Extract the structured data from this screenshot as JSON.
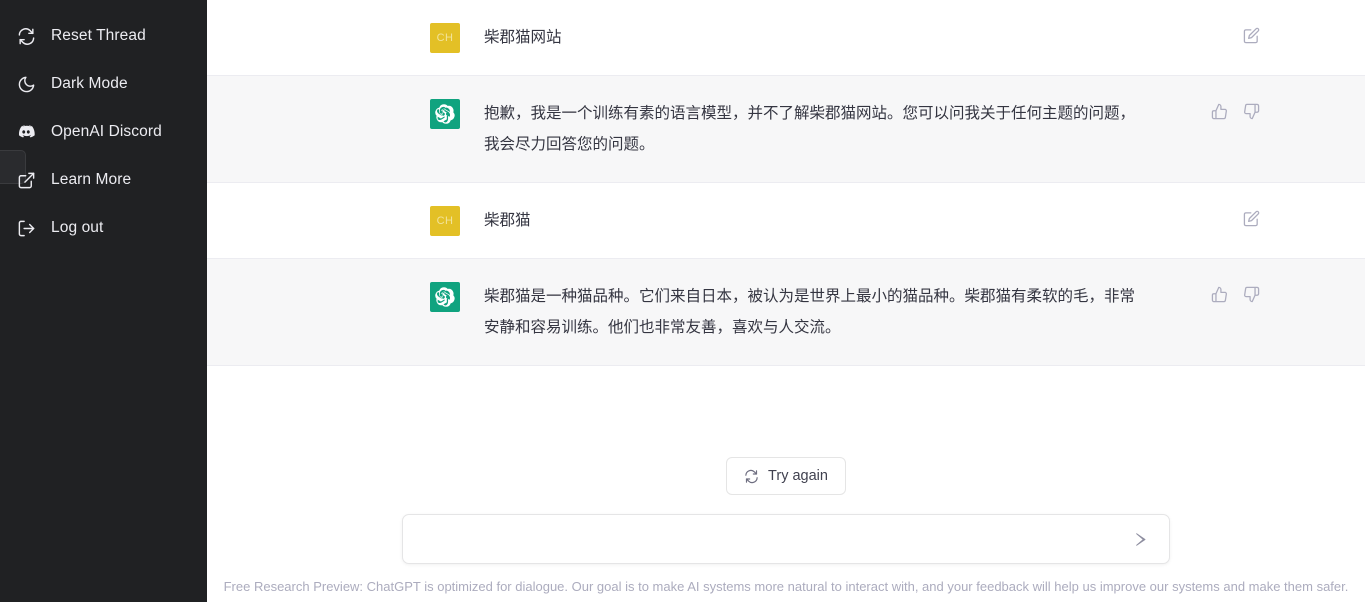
{
  "sidebar": {
    "items": [
      {
        "label": "Reset Thread",
        "icon": "reset-thread-icon"
      },
      {
        "label": "Dark Mode",
        "icon": "moon-icon"
      },
      {
        "label": "OpenAI Discord",
        "icon": "discord-icon"
      },
      {
        "label": "Learn More",
        "icon": "external-link-icon"
      },
      {
        "label": "Log out",
        "icon": "logout-icon"
      }
    ],
    "background_color": "#202123",
    "text_color": "#ececf1"
  },
  "conversation": {
    "messages": [
      {
        "role": "user",
        "avatar_initials": "CH",
        "avatar_color": "#e3c026",
        "text": "柴郡猫网站",
        "actions": [
          "edit-icon"
        ]
      },
      {
        "role": "assistant",
        "avatar_color": "#10a37f",
        "text": "抱歉，我是一个训练有素的语言模型，并不了解柴郡猫网站。您可以问我关于任何主题的问题，我会尽力回答您的问题。",
        "actions": [
          "thumbs-up-icon",
          "thumbs-down-icon"
        ]
      },
      {
        "role": "user",
        "avatar_initials": "CH",
        "avatar_color": "#e3c026",
        "text": "柴郡猫",
        "actions": [
          "edit-icon"
        ]
      },
      {
        "role": "assistant",
        "avatar_color": "#10a37f",
        "text": "柴郡猫是一种猫品种。它们来自日本，被认为是世界上最小的猫品种。柴郡猫有柔软的毛，非常安静和容易训练。他们也非常友善，喜欢与人交流。",
        "actions": [
          "thumbs-up-icon",
          "thumbs-down-icon"
        ]
      }
    ]
  },
  "composer": {
    "try_again_label": "Try again",
    "input_value": "",
    "input_placeholder": "",
    "send_icon": "send-arrow-icon"
  },
  "footer": {
    "note": "Free Research Preview: ChatGPT is optimized for dialogue. Our goal is to make AI systems more natural to interact with, and your feedback will help us improve our systems and make them safer."
  }
}
